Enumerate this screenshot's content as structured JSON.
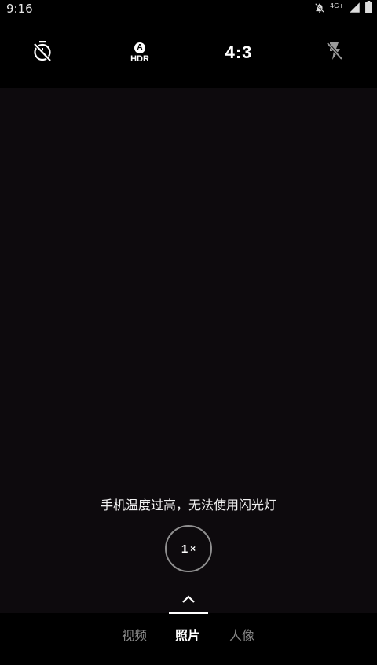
{
  "status_bar": {
    "time": "9:16",
    "network": "4G+",
    "icons": [
      "bell-off-icon",
      "signal-icon",
      "battery-icon"
    ]
  },
  "top_bar": {
    "timer_icon": "timer-off-icon",
    "hdr_badge": "A",
    "hdr_label": "HDR",
    "aspect_ratio": "4:3",
    "flash_icon": "flash-off-icon"
  },
  "viewfinder": {
    "warning": "手机温度过高，无法使用闪光灯",
    "zoom_value": "1",
    "zoom_suffix": "×"
  },
  "modes": [
    {
      "label": "视频",
      "active": false
    },
    {
      "label": "照片",
      "active": true
    },
    {
      "label": "人像",
      "active": false
    }
  ],
  "colors": {
    "background": "#000000",
    "viewfinder": "#0d0a0d",
    "inactive_mode": "#8a8a8a",
    "active_mode": "#ffffff"
  }
}
